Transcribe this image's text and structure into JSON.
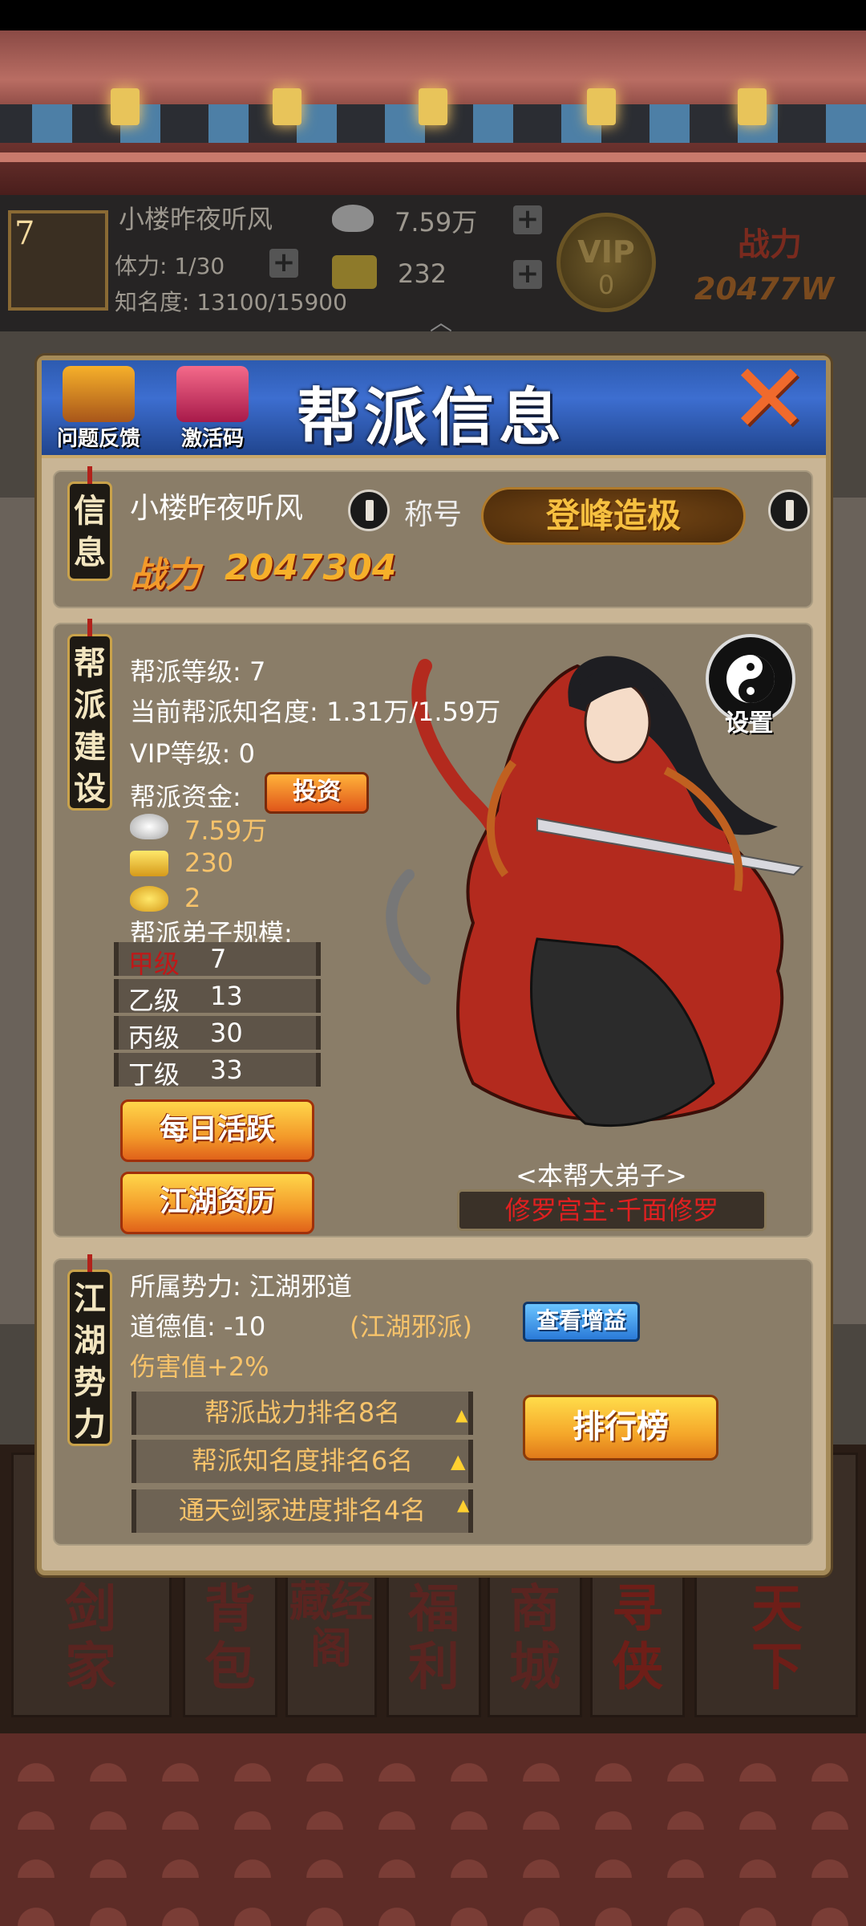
{
  "topbar": {
    "level": "7",
    "name": "小楼昨夜听风",
    "stamina": "体力: 1/30",
    "fame": "知名度: 13100/15900",
    "silver": "7.59万",
    "gold": "232",
    "vip_label": "VIP",
    "vip_level": "0",
    "power_label": "战力",
    "power_value": "20477W"
  },
  "dialog": {
    "title": "帮派信息",
    "feedback_label": "问题反馈",
    "activation_label": "激活码"
  },
  "info": {
    "badge": "信息",
    "name": "小楼昨夜听风",
    "title_label": "称号",
    "title_value": "登峰造极",
    "power_label": "战力",
    "power_value": "2047304"
  },
  "build": {
    "badge": "帮派建设",
    "level": "帮派等级:  7",
    "fame": "当前帮派知名度:  1.31万/1.59万",
    "vip": "VIP等级:   0",
    "funds_label": "帮派资金:",
    "invest_label": "投资",
    "silver": "7.59万",
    "gold_ingot": "230",
    "gold_coin": "2",
    "disciples_label": "帮派弟子规模:",
    "grades": [
      {
        "name": "甲级",
        "count": "7"
      },
      {
        "name": "乙级",
        "count": "13"
      },
      {
        "name": "丙级",
        "count": "30"
      },
      {
        "name": "丁级",
        "count": "33"
      }
    ],
    "daily_label": "每日活跃",
    "jianghu_label": "江湖资历",
    "settings_label": "设置",
    "disciple_tag": "<本帮大弟子>",
    "disciple_name": "修罗宫主·千面修罗"
  },
  "force": {
    "badge": "江湖势力",
    "faction": "所属势力:  江湖邪道",
    "morality": "道德值:  -10",
    "faction_tag": "(江湖邪派)",
    "view_bonus_label": "查看增益",
    "damage_bonus": "伤害值+2%",
    "ranks": [
      "帮派战力排名8名",
      "帮派知名度排名6名",
      "通天剑冢进度排名4名"
    ],
    "leaderboard_label": "排行榜"
  },
  "bottom_nav": [
    "剑家",
    "背包",
    "藏经阁",
    "福利",
    "商城",
    "寻侠",
    "天下"
  ],
  "colors": {
    "header_blue": "#2d5bb0",
    "panel": "#8a7d68",
    "gold_text": "#f7c36a",
    "red_text": "#c01818"
  }
}
